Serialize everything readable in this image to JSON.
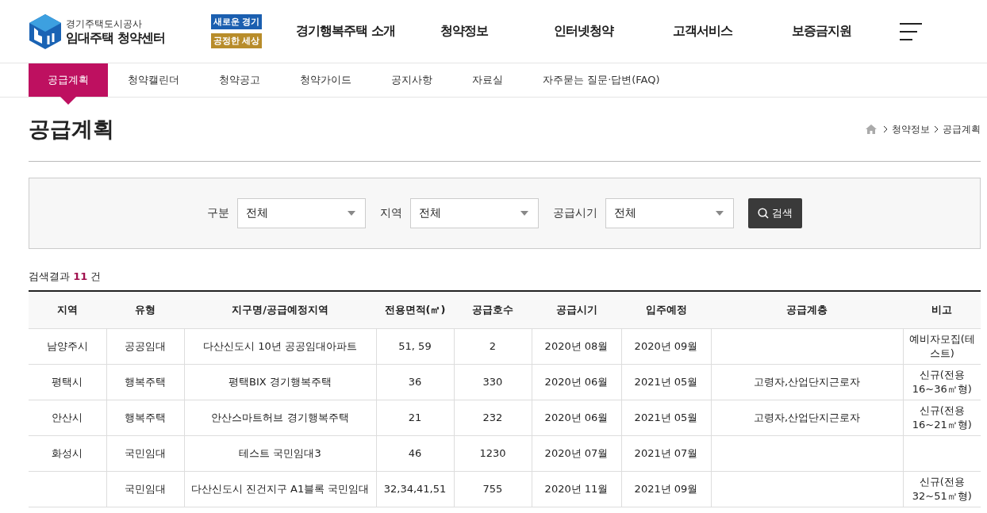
{
  "logo": {
    "org": "경기주택도시공사",
    "title": "임대주택 청약센터"
  },
  "slogan": {
    "top": "새로운 경기",
    "bottom": "공정한 세상"
  },
  "main_nav": [
    "경기행복주택 소개",
    "청약정보",
    "인터넷청약",
    "고객서비스",
    "보증금지원"
  ],
  "sub_nav": [
    {
      "label": "공급계획",
      "selected": true
    },
    {
      "label": "청약캘린더",
      "selected": false
    },
    {
      "label": "청약공고",
      "selected": false
    },
    {
      "label": "청약가이드",
      "selected": false
    },
    {
      "label": "공지사항",
      "selected": false
    },
    {
      "label": "자료실",
      "selected": false
    },
    {
      "label": "자주묻는 질문·답변(FAQ)",
      "selected": false
    }
  ],
  "page_title": "공급계획",
  "breadcrumb": [
    "청약정보",
    "공급계획"
  ],
  "filters": [
    {
      "label": "구분",
      "value": "전체"
    },
    {
      "label": "지역",
      "value": "전체"
    },
    {
      "label": "공급시기",
      "value": "전체"
    }
  ],
  "search_button": "검색",
  "result": {
    "prefix": "검색결과",
    "count": "11",
    "suffix": "건"
  },
  "table": {
    "columns": [
      "지역",
      "유형",
      "지구명/공급예정지역",
      "전용면적(㎡)",
      "공급호수",
      "공급시기",
      "입주예정",
      "공급계층",
      "비고"
    ],
    "rows": [
      {
        "cells": [
          "남양주시",
          "공공임대",
          "다산신도시 10년 공공임대아파트",
          "51, 59",
          "2",
          "2020년 08월",
          "2020년 09월",
          "",
          "예비자모집(테스트)"
        ]
      },
      {
        "cells": [
          "평택시",
          "행복주택",
          "평택BIX 경기행복주택",
          "36",
          "330",
          "2020년 06월",
          "2021년 05월",
          "고령자,산업단지근로자",
          "신규(전용 16~36㎡형)"
        ]
      },
      {
        "cells": [
          "안산시",
          "행복주택",
          "안산스마트허브 경기행복주택",
          "21",
          "232",
          "2020년 06월",
          "2021년 05월",
          "고령자,산업단지근로자",
          "신규(전용 16~21㎡형)"
        ]
      },
      {
        "cells": [
          "화성시",
          "국민임대",
          "테스트 국민임대3",
          "46",
          "1230",
          "2020년 07월",
          "2021년 07월",
          "",
          ""
        ]
      },
      {
        "cells": [
          "",
          "국민임대",
          "다산신도시 진건지구 A1블록 국민임대",
          "32,34,41,51",
          "755",
          "2020년 11월",
          "2021년 09월",
          "",
          "신규(전용 32~51㎡형)"
        ]
      }
    ]
  }
}
